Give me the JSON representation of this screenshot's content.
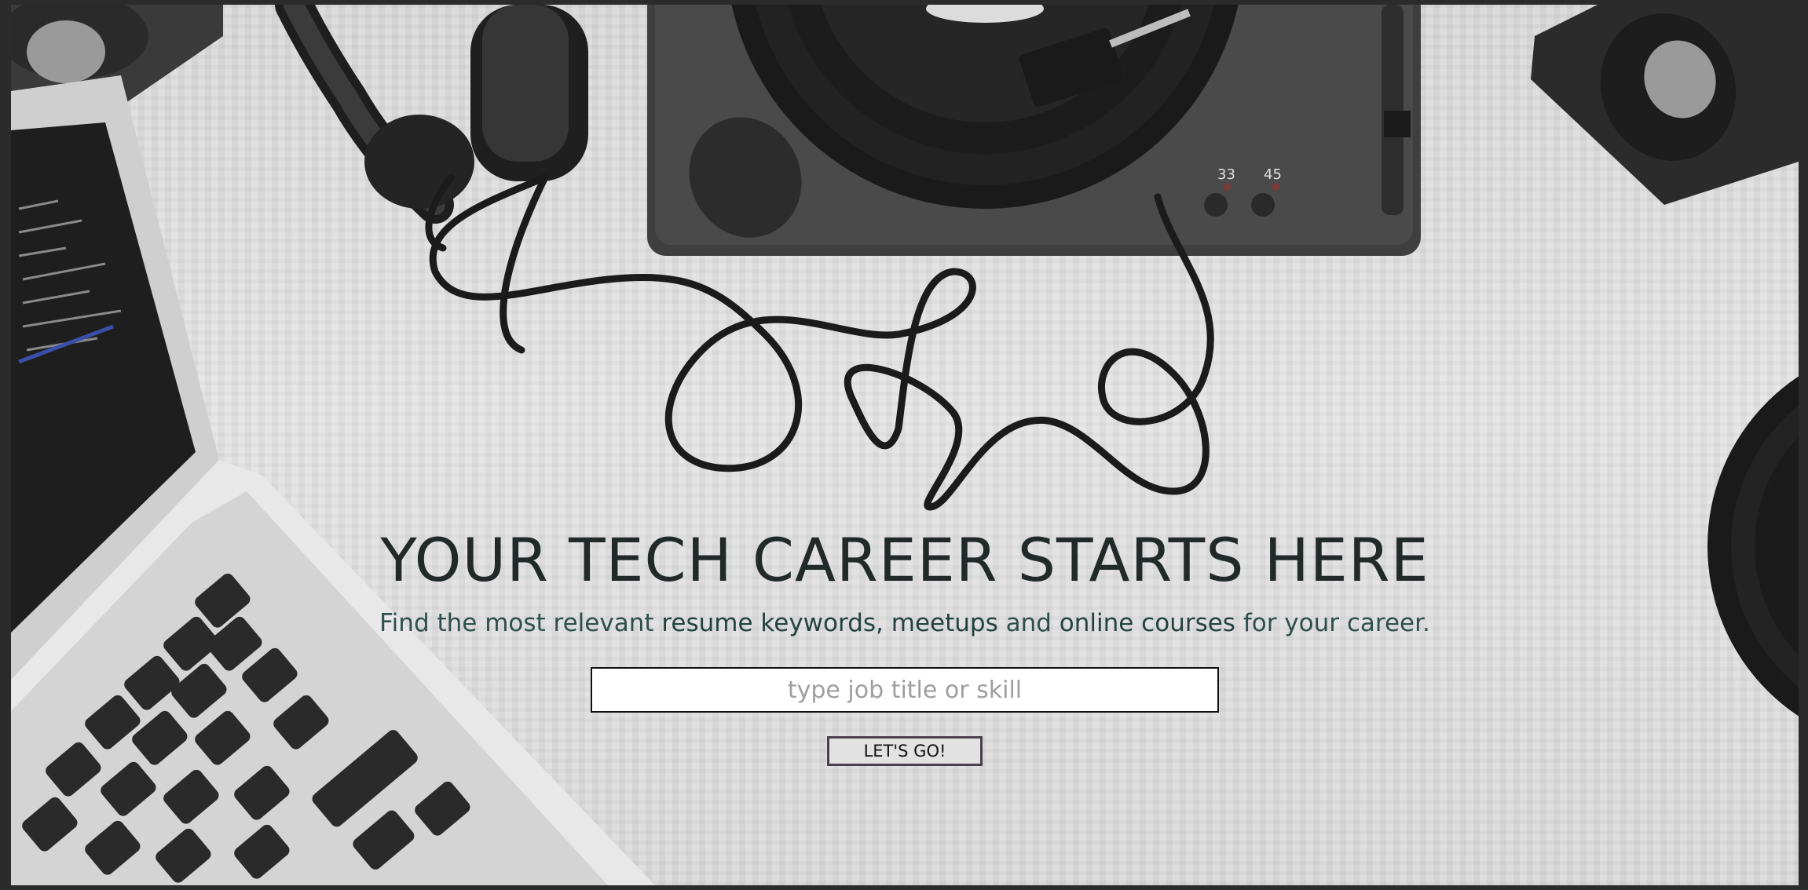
{
  "hero": {
    "title": "YOUR TECH CAREER STARTS HERE",
    "subtitle_start": "Find the most relevant ",
    "kw_resume": "resume keywords,",
    "kw_meetups": "meetups",
    "and": " and ",
    "kw_courses": "online courses",
    "subtitle_end": " for your career."
  },
  "search": {
    "placeholder": "type job title or skill",
    "value": ""
  },
  "submit": {
    "label": "LET'S GO!"
  },
  "turntable": {
    "speed_33": "33",
    "speed_45": "45"
  },
  "colors": {
    "title": "#222a29",
    "subtitle": "#2f4f4c",
    "button_border": "#4a3f4d",
    "button_bg": "#e2e2e2"
  }
}
